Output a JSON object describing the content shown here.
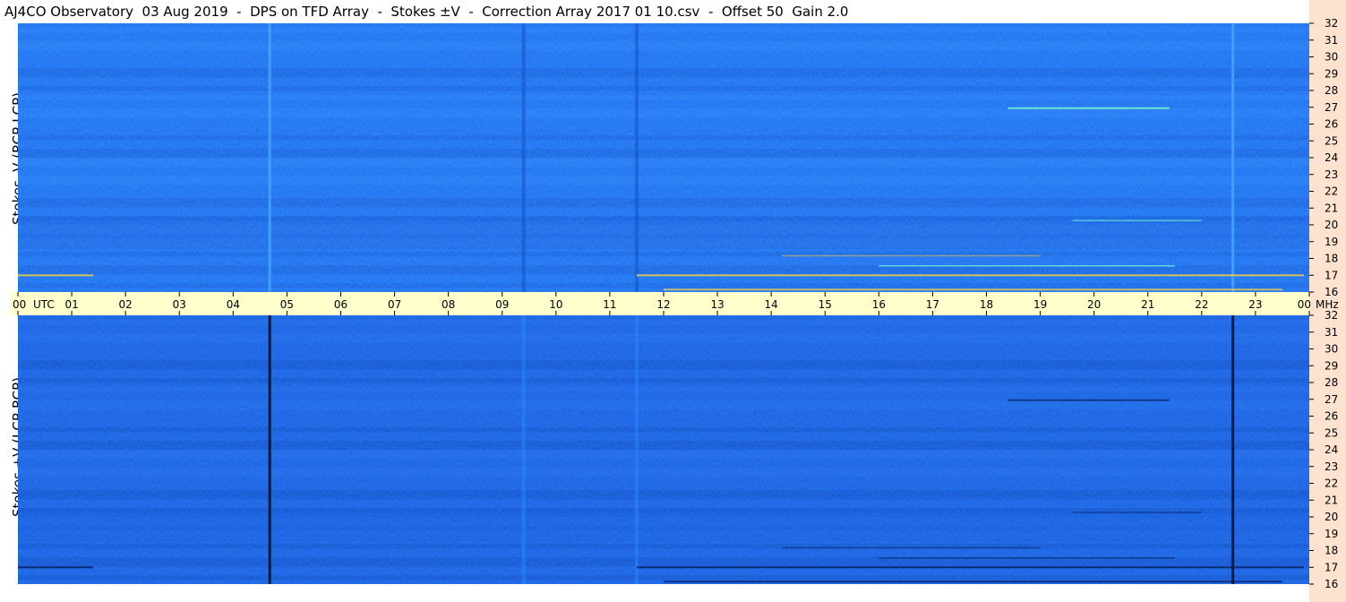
{
  "title": "AJ4CO Observatory  03 Aug 2019  -  DPS on TFD Array  -  Stokes ±V  -  Correction Array 2017 01 10.csv  -  Offset 50  Gain 2.0",
  "colors": {
    "background_blue": "#1a62e6",
    "time_axis_bg": "#ffffcc",
    "right_strip": "#fde2cf",
    "bright_line": "#3fa0ff",
    "dark_line": "#051a40"
  },
  "chart_data": [
    {
      "type": "heatmap",
      "panel": "top",
      "ylabel": "Stokes -V (RCP-LCP)",
      "x_unit": "UTC",
      "xlim": [
        0,
        24
      ],
      "y_unit": "MHz",
      "ylim": [
        16,
        32
      ],
      "y_ticks": [
        "16",
        "17",
        "18",
        "19",
        "20",
        "21",
        "22",
        "23",
        "24",
        "25",
        "26",
        "27",
        "28",
        "29",
        "30",
        "31",
        "32"
      ]
    },
    {
      "type": "heatmap",
      "panel": "bottom",
      "ylabel": "Stokes +V (LCP-RCP)",
      "x_unit": "UTC",
      "xlim": [
        0,
        24
      ],
      "y_unit": "MHz",
      "ylim": [
        16,
        32
      ],
      "y_ticks": [
        "16",
        "17",
        "18",
        "19",
        "20",
        "21",
        "22",
        "23",
        "24",
        "25",
        "26",
        "27",
        "28",
        "29",
        "30",
        "31",
        "32"
      ]
    }
  ],
  "time_axis": {
    "labels": [
      "00",
      "01",
      "02",
      "03",
      "04",
      "05",
      "06",
      "07",
      "08",
      "09",
      "10",
      "11",
      "12",
      "13",
      "14",
      "15",
      "16",
      "17",
      "18",
      "19",
      "20",
      "21",
      "22",
      "23",
      "00"
    ],
    "utc_label": "UTC",
    "mhz_label": "MHz"
  }
}
